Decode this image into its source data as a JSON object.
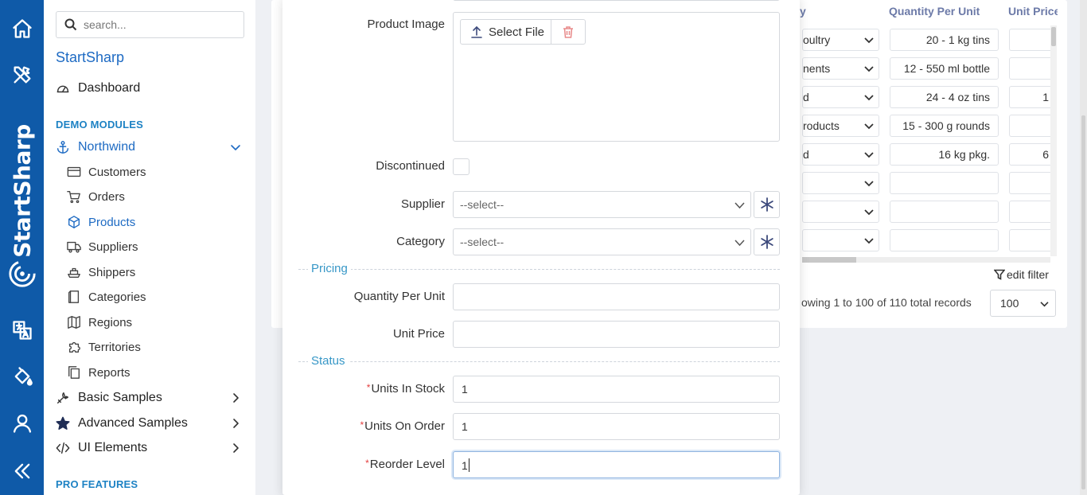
{
  "rail": {
    "brand_text": "StartSharp",
    "icons": [
      "home-icon",
      "tools-icon",
      "translate-icon",
      "paint-bucket-icon",
      "user-icon",
      "collapse-icon"
    ],
    "color": "#0f5aa8"
  },
  "sidebar": {
    "search_placeholder": "search...",
    "brand": "StartSharp",
    "dashboard": "Dashboard",
    "section_demo": "DEMO MODULES",
    "northwind": "Northwind",
    "items": [
      {
        "label": "Customers",
        "icon": "credit-card-icon"
      },
      {
        "label": "Orders",
        "icon": "cart-icon"
      },
      {
        "label": "Products",
        "icon": "box-icon",
        "active": true
      },
      {
        "label": "Suppliers",
        "icon": "truck-icon"
      },
      {
        "label": "Shippers",
        "icon": "ship-icon"
      },
      {
        "label": "Categories",
        "icon": "folder-icon"
      },
      {
        "label": "Regions",
        "icon": "map-icon"
      },
      {
        "label": "Territories",
        "icon": "puzzle-icon"
      },
      {
        "label": "Reports",
        "icon": "copy-icon"
      }
    ],
    "basic_samples": "Basic Samples",
    "advanced_samples": "Advanced Samples",
    "ui_elements": "UI Elements",
    "section_pro": "PRO FEATURES",
    "accent": "#1d6ac3"
  },
  "grid": {
    "col_category_fragment": "y",
    "col_qpu": "Quantity Per Unit",
    "col_price": "Unit Price",
    "rows": [
      {
        "category": "oultry",
        "qpu": "20 - 1 kg tins",
        "price": ""
      },
      {
        "category": "nents",
        "qpu": "12 - 550 ml bottle",
        "price": ""
      },
      {
        "category": "d",
        "qpu": "24 - 4 oz tins",
        "price": "1"
      },
      {
        "category": "roducts",
        "qpu": "15 - 300 g rounds",
        "price": ""
      },
      {
        "category": "d",
        "qpu": "16 kg pkg.",
        "price": "6"
      },
      {
        "category": "",
        "qpu": "",
        "price": ""
      },
      {
        "category": "",
        "qpu": "",
        "price": ""
      },
      {
        "category": "",
        "qpu": "",
        "price": ""
      }
    ],
    "edit_filter": "edit filter",
    "records_text": "owing 1 to 100 of 110 total records",
    "page_size": "100"
  },
  "dialog": {
    "product_image_label": "Product Image",
    "select_file": "Select File",
    "discontinued_label": "Discontinued",
    "discontinued_checked": false,
    "supplier_label": "Supplier",
    "supplier_value": "--select--",
    "category_label": "Category",
    "category_value": "--select--",
    "pricing_title": "Pricing",
    "qpu_label": "Quantity Per Unit",
    "qpu_value": "",
    "unit_price_label": "Unit Price",
    "unit_price_value": "",
    "status_title": "Status",
    "units_in_stock_label": "Units In Stock",
    "units_in_stock_value": "1",
    "units_on_order_label": "Units On Order",
    "units_on_order_value": "1",
    "reorder_level_label": "Reorder Level",
    "reorder_level_value": "1",
    "required_mark": "*"
  }
}
